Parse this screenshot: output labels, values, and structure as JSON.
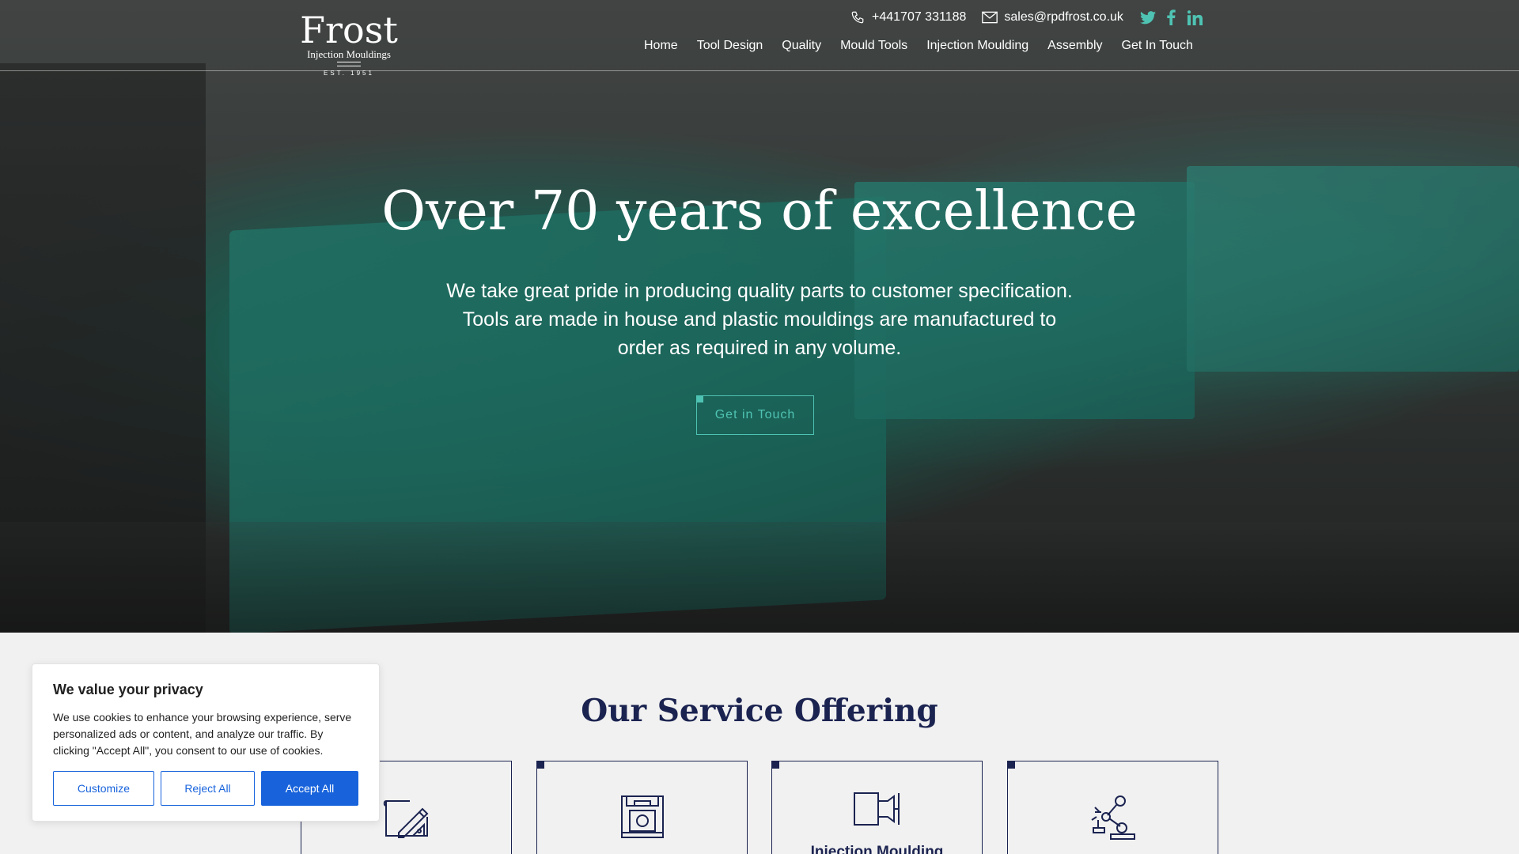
{
  "brand": {
    "name": "Frost",
    "subtitle": "Injection Mouldings",
    "established": "EST. 1951"
  },
  "contact": {
    "phone": "+441707 331188",
    "email": "sales@rpdfrost.co.uk"
  },
  "social": [
    "twitter-icon",
    "facebook-icon",
    "linkedin-icon"
  ],
  "nav": {
    "items": [
      "Home",
      "Tool Design",
      "Quality",
      "Mould Tools",
      "Injection Moulding",
      "Assembly",
      "Get In Touch"
    ]
  },
  "hero": {
    "title": "Over 70 years of excellence",
    "text": "We take great pride in producing quality parts to customer specification. Tools are made in house and plastic mouldings are manufactured to order as required in any volume.",
    "button": "Get in Touch"
  },
  "services": {
    "title": "Our Service Offering",
    "cards": [
      {
        "icon": "design-drawing-icon",
        "label": ""
      },
      {
        "icon": "mould-tool-icon",
        "label": ""
      },
      {
        "icon": "injection-moulding-icon",
        "label": "Injection Moulding"
      },
      {
        "icon": "robot-arm-icon",
        "label": ""
      }
    ]
  },
  "cookie": {
    "title": "We value your privacy",
    "text": "We use cookies to enhance your browsing experience, serve personalized ads or content, and analyze our traffic. By clicking \"Accept All\", you consent to our use of cookies.",
    "customize": "Customize",
    "reject": "Reject All",
    "accept": "Accept All"
  },
  "colors": {
    "accent": "#4fc3b3",
    "navy": "#1b2350",
    "cookieBlue": "#1863dc",
    "background": "#f1f1f1"
  }
}
